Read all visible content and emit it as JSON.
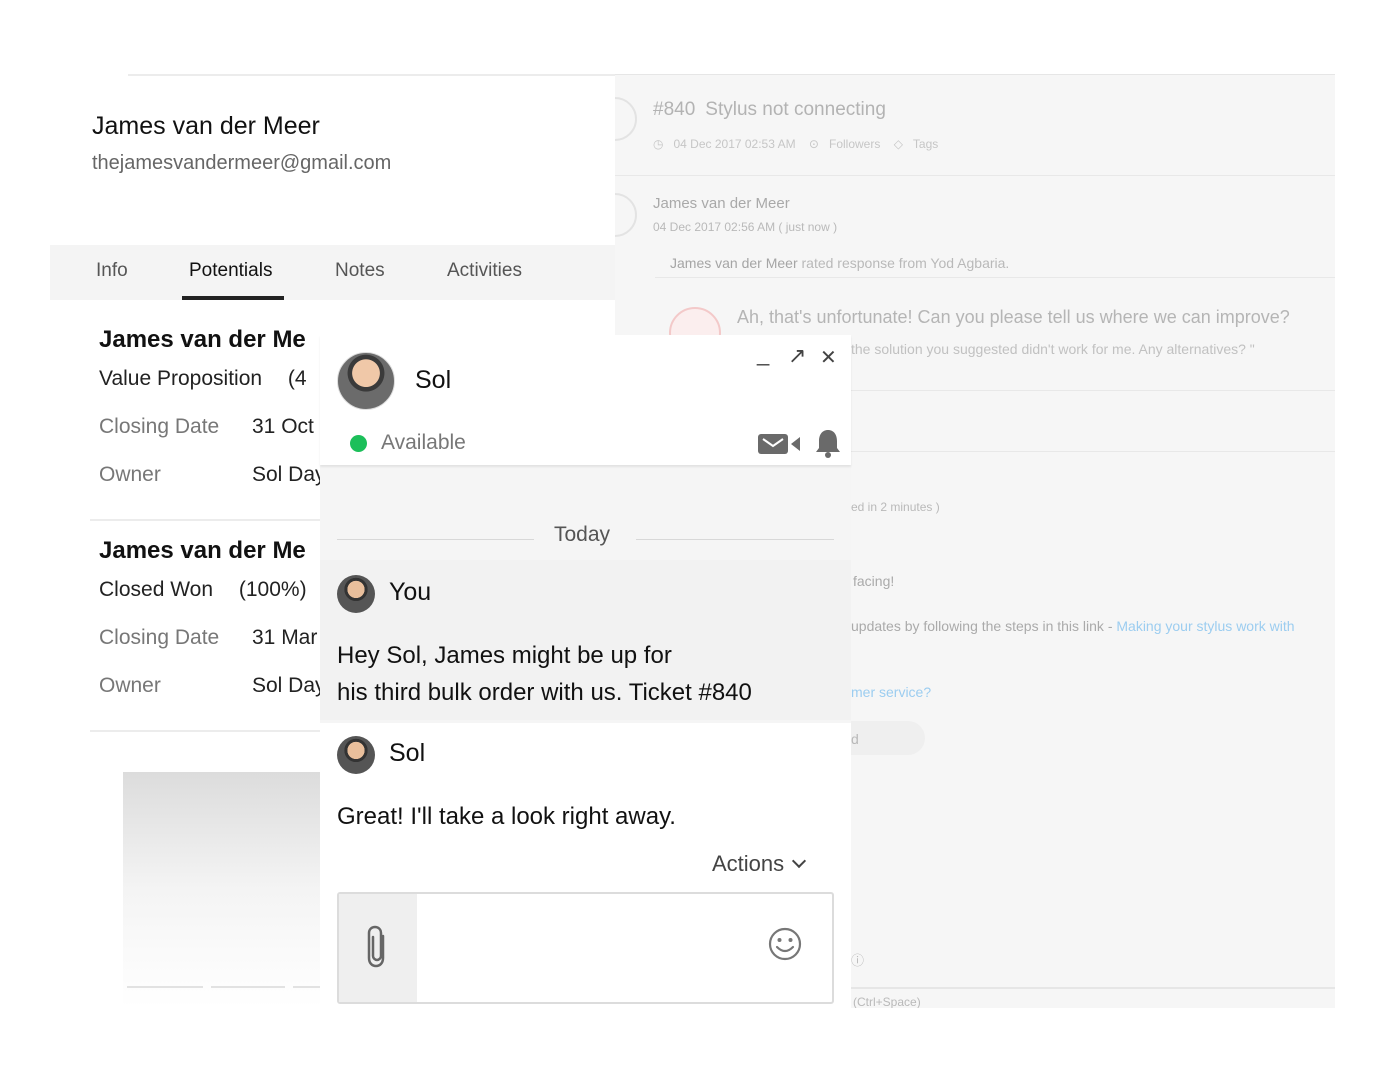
{
  "ticket": {
    "number": "#840",
    "subject": "Stylus not connecting",
    "created": "04 Dec 2017 02:53 AM",
    "followers_label": "Followers",
    "tags_label": "Tags",
    "thread_author": "James van der Meer",
    "thread_time": "04 Dec 2017 02:56 AM ( just now )",
    "rating_author": "James van der Meer",
    "rating_text": "rated response from Yod Agbaria.",
    "feedback_question": "Ah, that's unfortunate! Can you please tell us where we can improve?",
    "feedback_answer": "the solution you suggested didn't work for me. Any alternatives? \"",
    "fragment_time": "ed in 2 minutes )",
    "fragment_facing": "facing!",
    "fragment_updates": "updates by following the steps in this link  -",
    "fragment_link": "Making your stylus work with",
    "fragment_service": "mer service?",
    "fragment_d": "d",
    "fragment_shortcut": "(Ctrl+Space)"
  },
  "contact": {
    "name": "James van der Meer",
    "email": "thejamesvandermeer@gmail.com",
    "tabs": [
      {
        "label": "Info",
        "active": false
      },
      {
        "label": "Potentials",
        "active": true
      },
      {
        "label": "Notes",
        "active": false
      },
      {
        "label": "Activities",
        "active": false
      }
    ],
    "potentials": [
      {
        "name": "James van der Me",
        "stage": "Value Proposition",
        "percent": "(4",
        "closing_label": "Closing Date",
        "closing_value": "31 Oct :",
        "owner_label": "Owner",
        "owner_value": "Sol Day"
      },
      {
        "name": "James van der Me",
        "stage": "Closed Won",
        "percent": "(100%)",
        "closing_label": "Closing Date",
        "closing_value": "31 Mar",
        "owner_label": "Owner",
        "owner_value": "Sol Day"
      }
    ]
  },
  "chat": {
    "title": "Sol",
    "status": "Available",
    "status_color": "#1cbf5a",
    "controls": {
      "minimize": "_",
      "expand": "↗",
      "close": "✕"
    },
    "day_label": "Today",
    "messages": [
      {
        "author": "You",
        "text": "Hey Sol, James might be up for his third bulk order with us. Ticket #840"
      },
      {
        "author": "Sol",
        "text": "Great! I'll take a look right away."
      }
    ],
    "actions_label": "Actions",
    "composer": {
      "placeholder": ""
    }
  }
}
